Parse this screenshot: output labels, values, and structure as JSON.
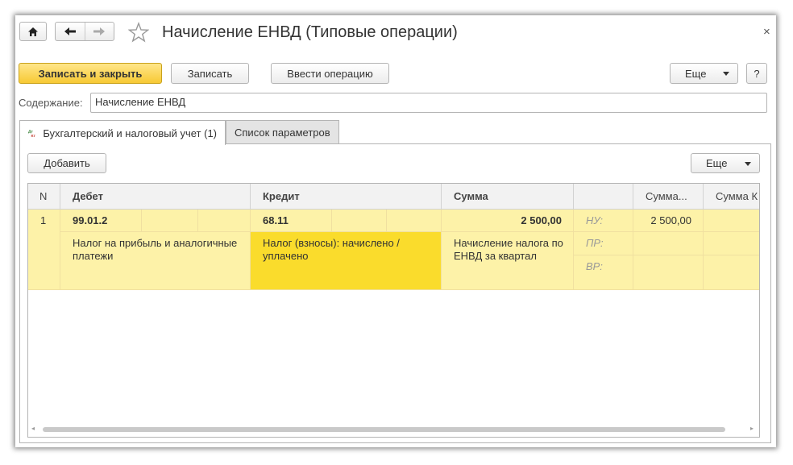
{
  "window": {
    "title": "Начисление ЕНВД (Типовые операции)",
    "close_symbol": "×"
  },
  "icons": {
    "home": "home-icon",
    "back": "arrow-left-icon",
    "forward": "arrow-right-icon",
    "favorite": "star-icon",
    "dropdown": "triangle-down-icon",
    "tab_dt_kt": "dt-kt-icon"
  },
  "toolbar": {
    "save_close_label": "Записать и закрыть",
    "save_label": "Записать",
    "enter_operation_label": "Ввести операцию",
    "more_label": "Еще",
    "help_label": "?"
  },
  "form": {
    "content_label": "Содержание:",
    "content_value": "Начисление ЕНВД"
  },
  "tabs": [
    {
      "label": "Бухгалтерский и налоговый учет (1)",
      "active": true
    },
    {
      "label": "Список параметров",
      "active": false
    }
  ],
  "table_toolbar": {
    "add_label": "Добавить",
    "more_label": "Еще"
  },
  "table": {
    "columns": [
      "N",
      "Дебет",
      "Кредит",
      "Сумма",
      "",
      "Сумма...",
      "Сумма К"
    ],
    "row": {
      "n": "1",
      "debit_account": "99.01.2",
      "credit_account": "68.11",
      "amount": "2 500,00",
      "nu_label": "НУ:",
      "pr_label": "ПР:",
      "vr_label": "ВР:",
      "nu_amount": "2 500,00",
      "debit_subconto": "Налог на прибыль и аналогичные платежи",
      "credit_subconto": "Налог (взносы): начислено / уплачено",
      "content": "Начисление налога по ЕНВД за квартал"
    }
  },
  "colors": {
    "primary_button": "#f7c934",
    "row_highlight": "#fdf2a8",
    "selected_cell": "#fadc2c"
  }
}
